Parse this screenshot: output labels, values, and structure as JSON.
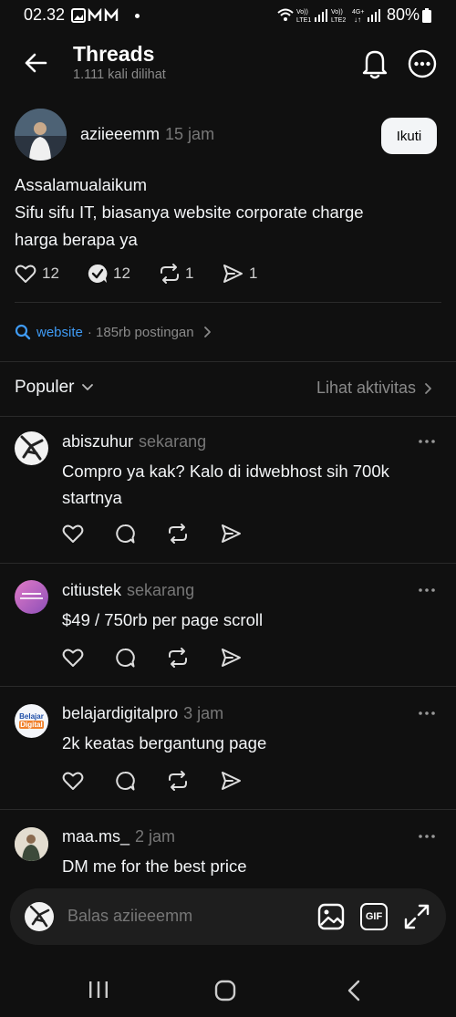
{
  "status_bar": {
    "time": "02.32",
    "battery": "80%"
  },
  "header": {
    "title": "Threads",
    "views": "1.111 kali dilihat"
  },
  "post": {
    "username": "aziieeemm",
    "time": "15 jam",
    "follow_label": "Ikuti",
    "lines": [
      "Assalamualaikum",
      "Sifu sifu IT, biasanya website corporate charge",
      "harga berapa ya"
    ],
    "likes": "12",
    "replies": "12",
    "reposts": "1",
    "shares": "1"
  },
  "topic": {
    "tag": "website",
    "count": "· 185rb postingan"
  },
  "sort": {
    "label": "Populer",
    "activity_link": "Lihat aktivitas"
  },
  "replies": [
    {
      "username": "abiszuhur",
      "time": "sekarang",
      "lines": [
        "Compro ya kak? Kalo di idwebhost sih 700k",
        "startnya"
      ]
    },
    {
      "username": "citiustek",
      "time": "sekarang",
      "lines": [
        "$49 / 750rb per page scroll"
      ]
    },
    {
      "username": "belajardigitalpro",
      "time": "3 jam",
      "lines": [
        "2k keatas bergantung page"
      ],
      "avatar_text": [
        "Belajar",
        "Digital"
      ]
    },
    {
      "username": "maa.ms_",
      "time": "2 jam",
      "lines": [
        "DM me for the best price"
      ]
    }
  ],
  "composer": {
    "placeholder": "Balas aziieeemm",
    "gif_label": "GIF"
  }
}
